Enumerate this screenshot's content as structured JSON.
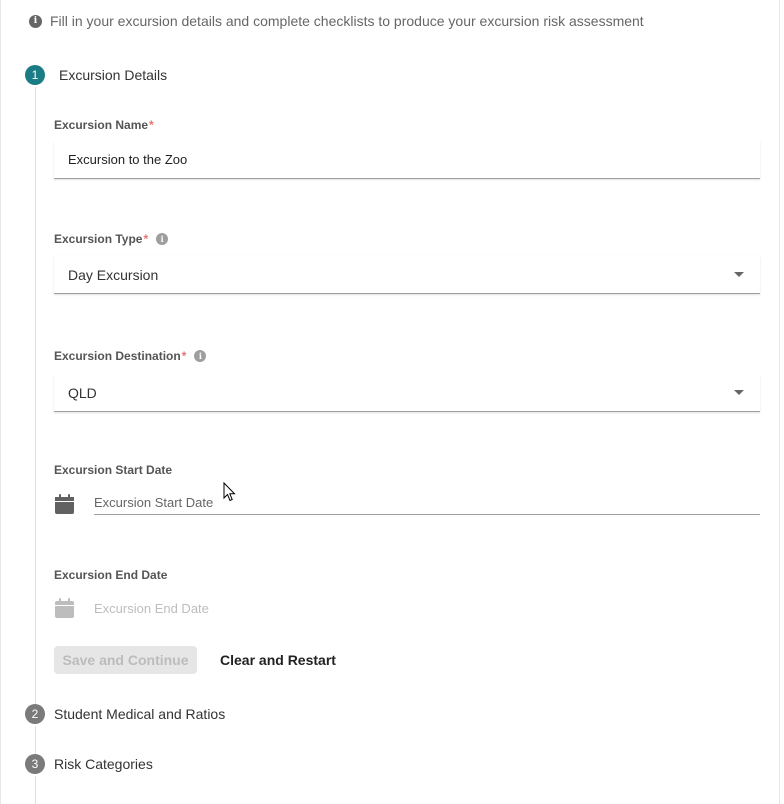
{
  "banner": {
    "text": "Fill in your excursion details and complete checklists to produce your excursion risk assessment"
  },
  "steps": [
    {
      "number": "1",
      "title": "Excursion Details",
      "state": "active"
    },
    {
      "number": "2",
      "title": "Student Medical and Ratios",
      "state": "inactive"
    },
    {
      "number": "3",
      "title": "Risk Categories",
      "state": "inactive"
    }
  ],
  "form": {
    "name": {
      "label": "Excursion Name",
      "required": "*",
      "value": "Excursion to the Zoo"
    },
    "type": {
      "label": "Excursion Type",
      "required": "*",
      "value": "Day Excursion"
    },
    "destination": {
      "label": "Excursion Destination",
      "required": "*",
      "value": "QLD"
    },
    "start_date": {
      "label": "Excursion Start Date",
      "placeholder": "Excursion Start Date"
    },
    "end_date": {
      "label": "Excursion End Date",
      "placeholder": "Excursion End Date"
    }
  },
  "actions": {
    "save_label": "Save and Continue",
    "clear_label": "Clear and Restart"
  },
  "colors": {
    "accent": "#1a7d86",
    "inactive_step": "#7a7a7a",
    "required": "#e57373",
    "disabled_bg": "#e6e6e6"
  }
}
